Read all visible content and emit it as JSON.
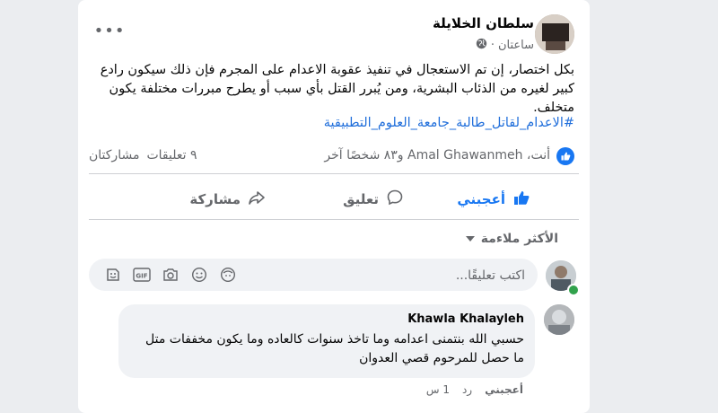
{
  "post": {
    "author": "سلطان الخلايلة",
    "time": "ساعتان",
    "separator": "·",
    "privacy_icon": "globe-icon",
    "more_icon": "more-icon",
    "text": "بكل اختصار، إن تم الاستعجال في تنفيذ عقوبة الاعدام على المجرم فإن ذلك سيكون رادع كبير لغيره من الذئاب البشرية، ومن يُبرر القتل بأي سبب أو يطرح مبررات مختلفة يكون متخلف.",
    "hashtag": "#الاعدام_لقاتل_طالبة_جامعة_العلوم_التطبيقية"
  },
  "reactions": {
    "icon": "like-reaction-icon",
    "names": "أنت، Amal Ghawanmeh و٨٣ شخصًا آخر",
    "comments": "٩ تعليقات",
    "shares": "مشاركتان"
  },
  "actions": {
    "like": "أعجبني",
    "comment": "تعليق",
    "share": "مشاركة"
  },
  "sort": {
    "label": "الأكثر ملاءمة",
    "icon": "caret-down-icon"
  },
  "composer": {
    "placeholder": "اكتب تعليقًا...",
    "icons": [
      "avatar-sticker-icon",
      "emoji-icon",
      "camera-icon",
      "gif-icon",
      "sticker-icon"
    ]
  },
  "comment": {
    "author": "Khawla Khalayleh",
    "text": "حسبي الله بنتمنى اعدامه وما تاخذ سنوات كالعاده وما يكون مخففات متل ما حصل للمرحوم قصي العدوان",
    "like": "أعجبني",
    "reply": "رد",
    "time": "1 س"
  },
  "colors": {
    "accent": "#1877f2",
    "link": "#216fdb",
    "muted": "#65676b",
    "online": "#31a24c"
  }
}
